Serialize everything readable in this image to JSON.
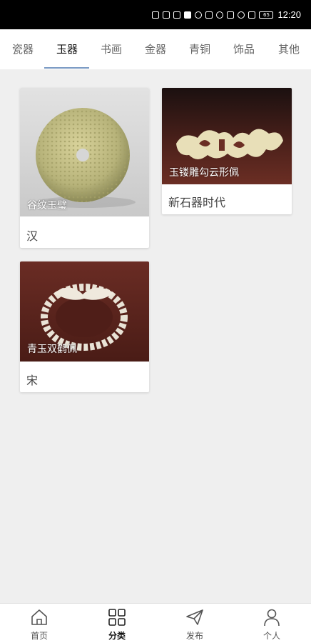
{
  "status_bar": {
    "time": "12:20",
    "battery": "65",
    "icons": [
      "hd-icon",
      "signal-icon",
      "wifi-icon",
      "notification-icon",
      "message-icon",
      "key-icon",
      "eye-icon",
      "nfc-icon",
      "alarm-icon",
      "mute-icon",
      "battery-icon"
    ]
  },
  "tabs": [
    {
      "label": "瓷器",
      "active": false
    },
    {
      "label": "玉器",
      "active": true
    },
    {
      "label": "书画",
      "active": false
    },
    {
      "label": "金器",
      "active": false
    },
    {
      "label": "青铜",
      "active": false
    },
    {
      "label": "饰品",
      "active": false
    },
    {
      "label": "其他",
      "active": false
    }
  ],
  "cards": [
    {
      "image_title": "谷纹玉璧",
      "subtitle": "汉",
      "image": "jade-bi-disc"
    },
    {
      "image_title": "玉镂雕勾云形佩",
      "subtitle": "新石器时代",
      "image": "jade-cloud-pendant"
    },
    {
      "image_title": "青玉双鹤佩",
      "subtitle": "宋",
      "image": "jade-double-crane-pendant"
    }
  ],
  "bottom_nav": [
    {
      "label": "首页",
      "icon": "home-icon",
      "active": false
    },
    {
      "label": "分类",
      "icon": "category-grid-icon",
      "active": true
    },
    {
      "label": "发布",
      "icon": "send-icon",
      "active": false
    },
    {
      "label": "个人",
      "icon": "person-icon",
      "active": false
    }
  ],
  "colors": {
    "background": "#efefef",
    "tab_underline": "#7a9ac4",
    "status_bar": "#000000"
  }
}
